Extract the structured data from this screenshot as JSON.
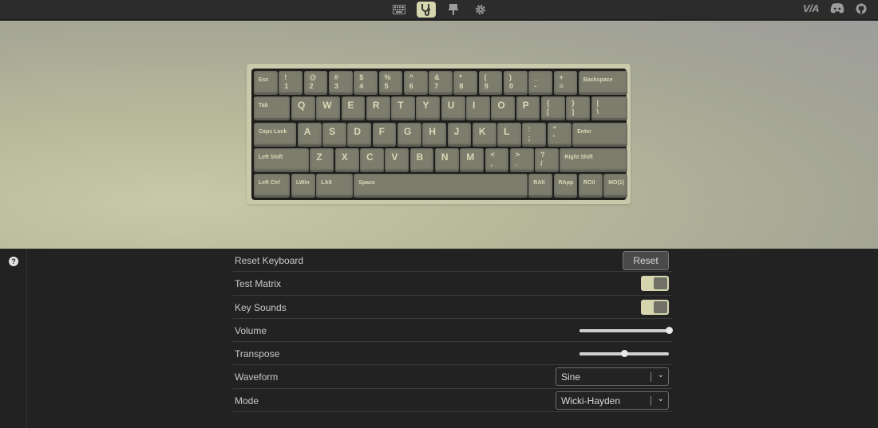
{
  "topbar": {
    "nav": [
      {
        "name": "keyboard-icon",
        "active": false
      },
      {
        "name": "stethoscope-icon",
        "active": true
      },
      {
        "name": "download-icon",
        "active": false
      },
      {
        "name": "gear-icon",
        "active": false
      }
    ],
    "via_label": "V/A"
  },
  "keyboard": {
    "rows": [
      [
        {
          "l": "Esc"
        },
        {
          "t": "!",
          "b": "1"
        },
        {
          "t": "@",
          "b": "2"
        },
        {
          "t": "#",
          "b": "3"
        },
        {
          "t": "$",
          "b": "4"
        },
        {
          "t": "%",
          "b": "5"
        },
        {
          "t": "^",
          "b": "6"
        },
        {
          "t": "&",
          "b": "7"
        },
        {
          "t": "*",
          "b": "8"
        },
        {
          "t": "(",
          "b": "9"
        },
        {
          "t": ")",
          "b": "0"
        },
        {
          "t": "_",
          "b": "-"
        },
        {
          "t": "+",
          "b": "="
        },
        {
          "l": "Backspace"
        }
      ],
      [
        {
          "l": "Tab"
        },
        {
          "g": "Q"
        },
        {
          "g": "W"
        },
        {
          "g": "E"
        },
        {
          "g": "R"
        },
        {
          "g": "T"
        },
        {
          "g": "Y"
        },
        {
          "g": "U"
        },
        {
          "g": "I"
        },
        {
          "g": "O"
        },
        {
          "g": "P"
        },
        {
          "t": "{",
          "b": "["
        },
        {
          "t": "}",
          "b": "]"
        },
        {
          "t": "|",
          "b": "\\"
        }
      ],
      [
        {
          "l": "Caps Lock"
        },
        {
          "g": "A"
        },
        {
          "g": "S"
        },
        {
          "g": "D"
        },
        {
          "g": "F"
        },
        {
          "g": "G"
        },
        {
          "g": "H"
        },
        {
          "g": "J"
        },
        {
          "g": "K"
        },
        {
          "g": "L"
        },
        {
          "t": ":",
          "b": ";"
        },
        {
          "t": "\"",
          "b": "'"
        },
        {
          "l": "Enter"
        }
      ],
      [
        {
          "l": "Left Shift"
        },
        {
          "g": "Z"
        },
        {
          "g": "X"
        },
        {
          "g": "C"
        },
        {
          "g": "V"
        },
        {
          "g": "B"
        },
        {
          "g": "N"
        },
        {
          "g": "M"
        },
        {
          "t": "<",
          "b": ","
        },
        {
          "t": ">",
          "b": "."
        },
        {
          "t": "?",
          "b": "/"
        },
        {
          "l": "Right Shift"
        }
      ],
      [
        {
          "l": "Left Ctrl"
        },
        {
          "l": "LWin"
        },
        {
          "l": "LAlt"
        },
        {
          "l": "Space"
        },
        {
          "l": "RAlt"
        },
        {
          "l": "RApp"
        },
        {
          "l": "RCtl"
        },
        {
          "l": "MO(1)"
        }
      ]
    ]
  },
  "settings": {
    "reset_keyboard": {
      "label": "Reset Keyboard",
      "button": "Reset"
    },
    "test_matrix": {
      "label": "Test Matrix",
      "on": true
    },
    "key_sounds": {
      "label": "Key Sounds",
      "on": true
    },
    "volume": {
      "label": "Volume",
      "value": 1.0
    },
    "transpose": {
      "label": "Transpose",
      "value": 0.5
    },
    "waveform": {
      "label": "Waveform",
      "selected": "Sine"
    },
    "mode": {
      "label": "Mode",
      "selected": "Wicki-Hayden"
    }
  },
  "colors": {
    "accent": "#d5d6b0",
    "key": "#78786a",
    "legend": "#d7d8b5"
  }
}
